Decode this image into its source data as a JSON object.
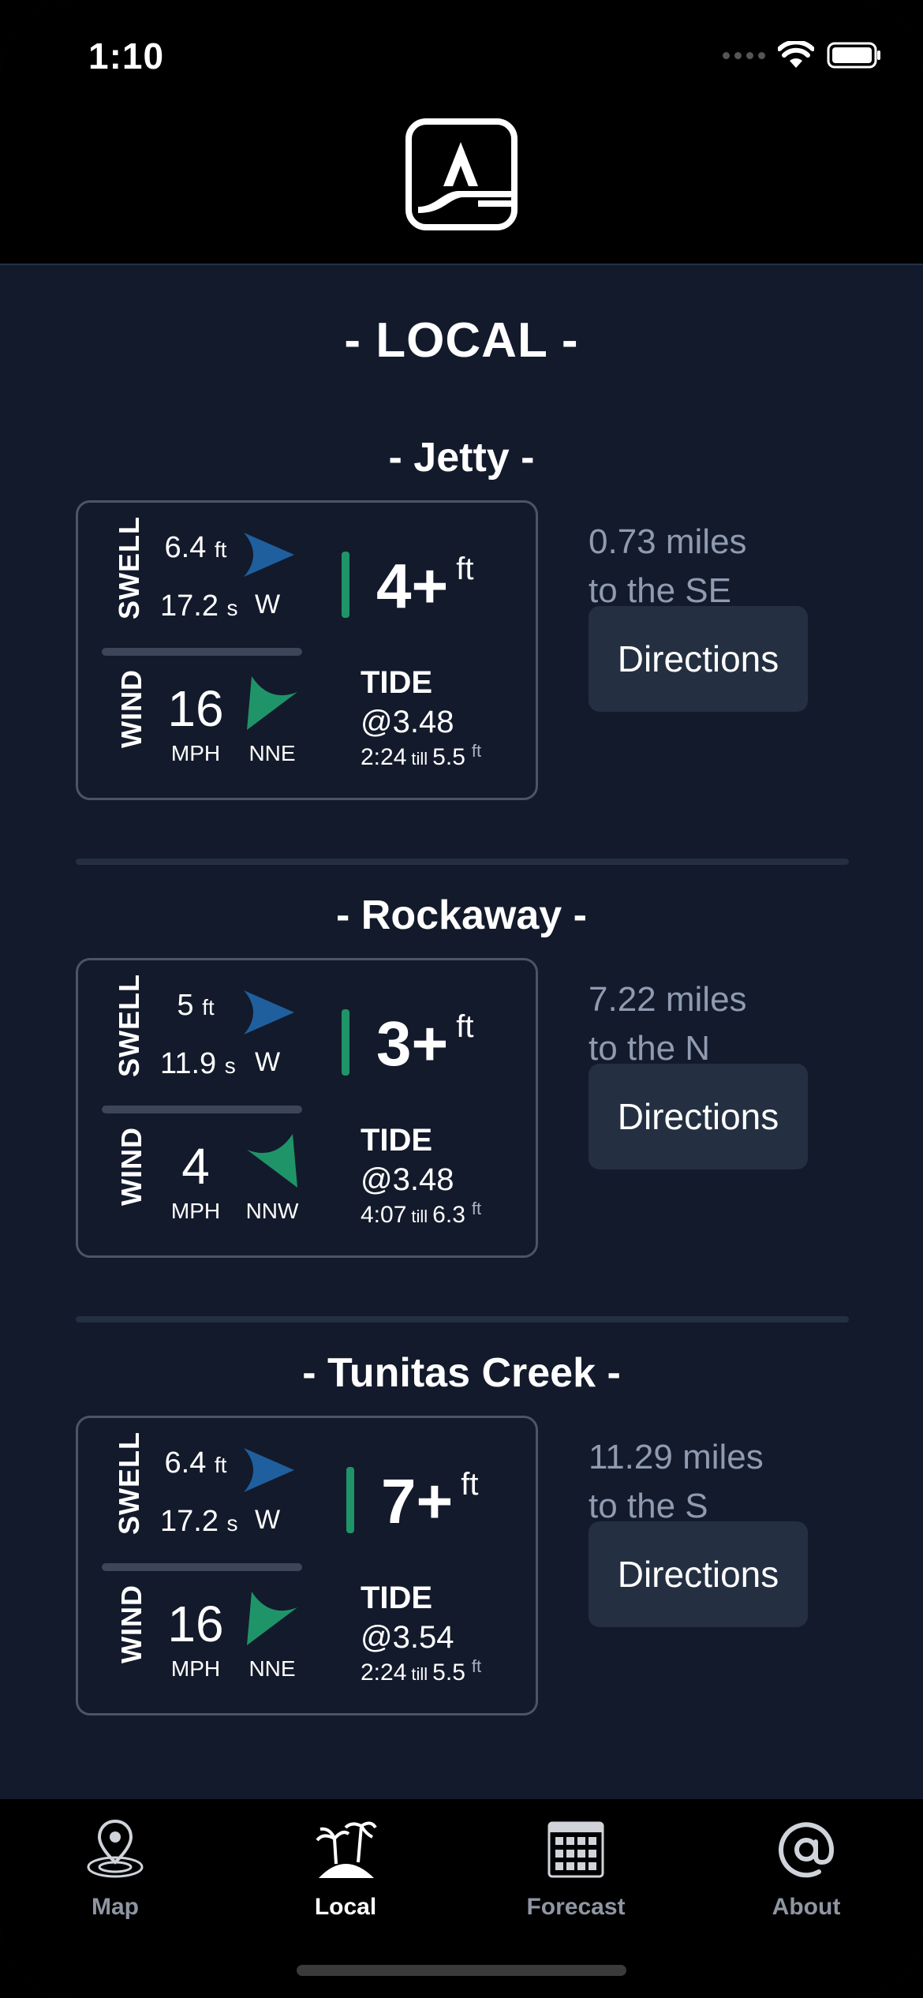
{
  "status_bar": {
    "time": "1:10"
  },
  "header": {
    "logo_icon": "app-logo-icon"
  },
  "page": {
    "title": "- LOCAL -"
  },
  "spots": [
    {
      "name": "- Jetty -",
      "swell": {
        "label": "SWELL",
        "height": "6.4",
        "height_unit": "ft",
        "period": "17.2",
        "period_unit": "s",
        "direction": "W"
      },
      "wave": {
        "height": "4+",
        "unit": "ft"
      },
      "wind": {
        "label": "WIND",
        "speed": "16",
        "unit": "MPH",
        "direction": "NNE"
      },
      "tide": {
        "label": "TIDE",
        "height": "@3.48",
        "time": "2:24",
        "till": "till",
        "next": "5.5",
        "unit": "ft"
      },
      "distance": {
        "miles": "0.73 miles",
        "direction": "to the SE"
      },
      "button": "Directions"
    },
    {
      "name": "- Rockaway -",
      "swell": {
        "label": "SWELL",
        "height": "5",
        "height_unit": "ft",
        "period": "11.9",
        "period_unit": "s",
        "direction": "W"
      },
      "wave": {
        "height": "3+",
        "unit": "ft"
      },
      "wind": {
        "label": "WIND",
        "speed": "4",
        "unit": "MPH",
        "direction": "NNW"
      },
      "tide": {
        "label": "TIDE",
        "height": "@3.48",
        "time": "4:07",
        "till": "till",
        "next": "6.3",
        "unit": "ft"
      },
      "distance": {
        "miles": "7.22 miles",
        "direction": "to the N"
      },
      "button": "Directions"
    },
    {
      "name": "- Tunitas Creek -",
      "swell": {
        "label": "SWELL",
        "height": "6.4",
        "height_unit": "ft",
        "period": "17.2",
        "period_unit": "s",
        "direction": "W"
      },
      "wave": {
        "height": "7+",
        "unit": "ft"
      },
      "wind": {
        "label": "WIND",
        "speed": "16",
        "unit": "MPH",
        "direction": "NNE"
      },
      "tide": {
        "label": "TIDE",
        "height": "@3.54",
        "time": "2:24",
        "till": "till",
        "next": "5.5",
        "unit": "ft"
      },
      "distance": {
        "miles": "11.29 miles",
        "direction": "to the S"
      },
      "button": "Directions"
    }
  ],
  "tabs": [
    {
      "label": "Map",
      "icon": "map-pin-icon",
      "active": false
    },
    {
      "label": "Local",
      "icon": "palm-island-icon",
      "active": true
    },
    {
      "label": "Forecast",
      "icon": "calendar-icon",
      "active": false
    },
    {
      "label": "About",
      "icon": "at-sign-icon",
      "active": false
    }
  ],
  "colors": {
    "background": "#131a2b",
    "swell_arrow": "#1f5f9e",
    "wind_arrow": "#1f9468",
    "accent_bar": "#1f9468",
    "button": "#243042"
  }
}
